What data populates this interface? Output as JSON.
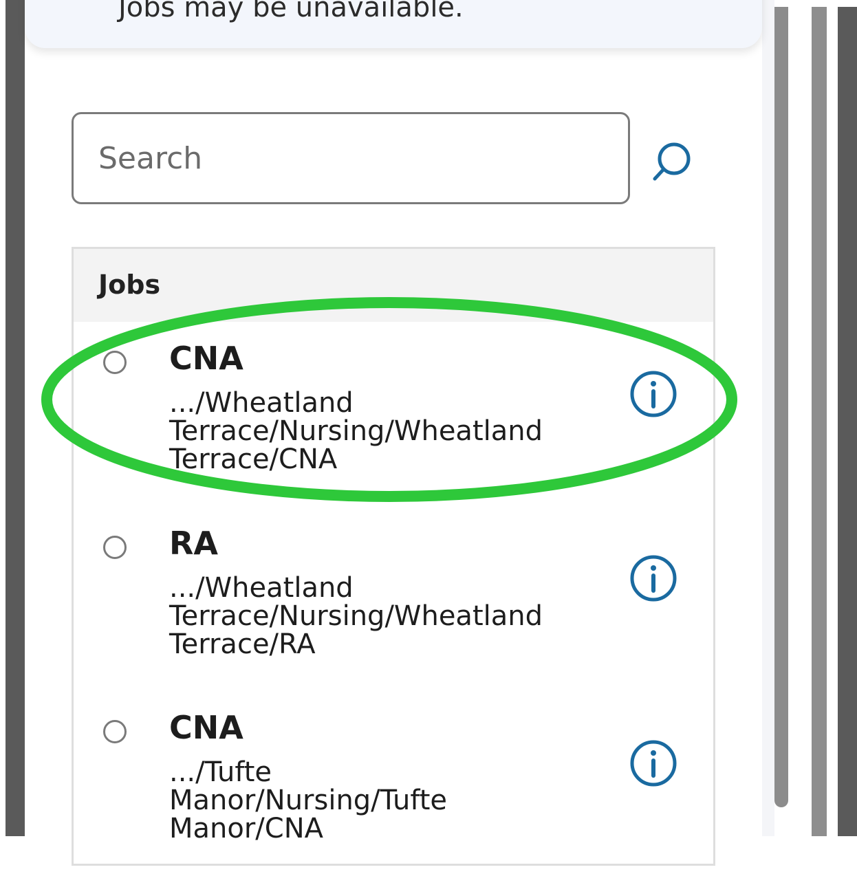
{
  "notice": {
    "text": "Jobs may be unavailable."
  },
  "search": {
    "placeholder": "Search"
  },
  "jobs": {
    "title": "Jobs",
    "items": [
      {
        "title": "CNA",
        "path": [
          ".../Wheatland",
          "Terrace/Nursing/Wheatland",
          "Terrace/CNA"
        ]
      },
      {
        "title": "RA",
        "path": [
          ".../Wheatland",
          "Terrace/Nursing/Wheatland",
          "Terrace/RA"
        ]
      },
      {
        "title": "CNA",
        "path": [
          ".../Tufte",
          "Manor/Nursing/Tufte",
          "Manor/CNA"
        ]
      }
    ]
  },
  "colors": {
    "accent": "#1a6aa0",
    "highlight": "#2ec83a",
    "border": "#7a7a7a",
    "header_bg": "#f3f3f3"
  },
  "icons": {
    "search": "search-icon",
    "info": "info-icon"
  }
}
